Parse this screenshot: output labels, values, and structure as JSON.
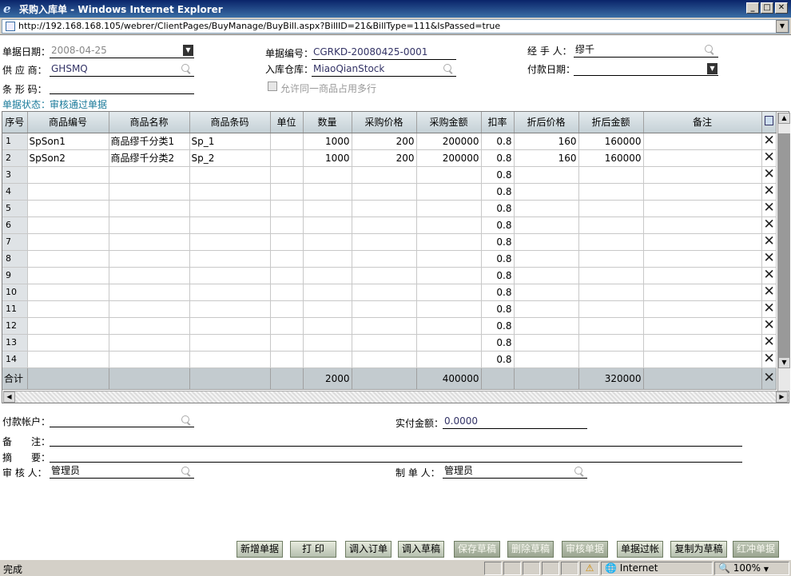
{
  "window": {
    "title": "采购入库单 - Windows Internet Explorer",
    "min": "_",
    "max": "□",
    "close": "✕"
  },
  "address": {
    "url": "http://192.168.168.105/webrer/ClientPages/BuyManage/BuyBill.aspx?BillID=21&BillType=111&IsPassed=true"
  },
  "form": {
    "bill_date_label": "单据日期：",
    "bill_date": "2008-04-25",
    "bill_no_label": "单据编号：",
    "bill_no": "CGRKD-20080425-0001",
    "handler_label": "经 手 人：",
    "handler": "缪千",
    "supplier_label": "供 应 商：",
    "supplier": "GHSMQ",
    "warehouse_label": "入库仓库：",
    "warehouse": "MiaoQianStock",
    "pay_date_label": "付款日期：",
    "pay_date": "",
    "barcode_label": "条 形 码：",
    "barcode": "",
    "allow_multi": "允许同一商品占用多行",
    "status_label": "单据状态：",
    "status": "审核通过单据"
  },
  "grid": {
    "headers": [
      "序号",
      "商品编号",
      "商品名称",
      "商品条码",
      "单位",
      "数量",
      "采购价格",
      "采购金额",
      "扣率",
      "折后价格",
      "折后金额",
      "备注"
    ],
    "rows": [
      [
        "1",
        "SpSon1",
        "商品缪千分类1",
        "Sp_1",
        "",
        "1000",
        "200",
        "200000",
        "0.8",
        "160",
        "160000",
        ""
      ],
      [
        "2",
        "SpSon2",
        "商品缪千分类2",
        "Sp_2",
        "",
        "1000",
        "200",
        "200000",
        "0.8",
        "160",
        "160000",
        ""
      ],
      [
        "3",
        "",
        "",
        "",
        "",
        "",
        "",
        "",
        "0.8",
        "",
        "",
        ""
      ],
      [
        "4",
        "",
        "",
        "",
        "",
        "",
        "",
        "",
        "0.8",
        "",
        "",
        ""
      ],
      [
        "5",
        "",
        "",
        "",
        "",
        "",
        "",
        "",
        "0.8",
        "",
        "",
        ""
      ],
      [
        "6",
        "",
        "",
        "",
        "",
        "",
        "",
        "",
        "0.8",
        "",
        "",
        ""
      ],
      [
        "7",
        "",
        "",
        "",
        "",
        "",
        "",
        "",
        "0.8",
        "",
        "",
        ""
      ],
      [
        "8",
        "",
        "",
        "",
        "",
        "",
        "",
        "",
        "0.8",
        "",
        "",
        ""
      ],
      [
        "9",
        "",
        "",
        "",
        "",
        "",
        "",
        "",
        "0.8",
        "",
        "",
        ""
      ],
      [
        "10",
        "",
        "",
        "",
        "",
        "",
        "",
        "",
        "0.8",
        "",
        "",
        ""
      ],
      [
        "11",
        "",
        "",
        "",
        "",
        "",
        "",
        "",
        "0.8",
        "",
        "",
        ""
      ],
      [
        "12",
        "",
        "",
        "",
        "",
        "",
        "",
        "",
        "0.8",
        "",
        "",
        ""
      ],
      [
        "13",
        "",
        "",
        "",
        "",
        "",
        "",
        "",
        "0.8",
        "",
        "",
        ""
      ],
      [
        "14",
        "",
        "",
        "",
        "",
        "",
        "",
        "",
        "0.8",
        "",
        "",
        ""
      ]
    ],
    "totals": [
      "合计",
      "",
      "",
      "",
      "",
      "2000",
      "",
      "400000",
      "",
      "",
      "320000",
      ""
    ],
    "delete_glyph": "✕",
    "copy_icon": "copy-icon"
  },
  "footer": {
    "account_label": "付款帐户：",
    "account": "",
    "paid_label": "实付金额：",
    "paid": "0.0000",
    "note_label": "备　　注：",
    "note": "",
    "summary_label": "摘　　要：",
    "summary": "",
    "auditor_label": "审 核 人：",
    "auditor": "管理员",
    "maker_label": "制 单 人：",
    "maker": "管理员"
  },
  "buttons": [
    {
      "label": "新增单据",
      "enabled": true
    },
    {
      "label": "打 印",
      "enabled": true
    },
    {
      "label": "调入订单",
      "enabled": true
    },
    {
      "label": "调入草稿",
      "enabled": true
    },
    {
      "label": "保存草稿",
      "enabled": false
    },
    {
      "label": "删除草稿",
      "enabled": false
    },
    {
      "label": "审核单据",
      "enabled": false
    },
    {
      "label": "单据过帐",
      "enabled": true
    },
    {
      "label": "复制为草稿",
      "enabled": true
    },
    {
      "label": "红冲单据",
      "enabled": false
    }
  ],
  "statusbar": {
    "text": "完成",
    "zone": "Internet",
    "zoom": "100%"
  }
}
